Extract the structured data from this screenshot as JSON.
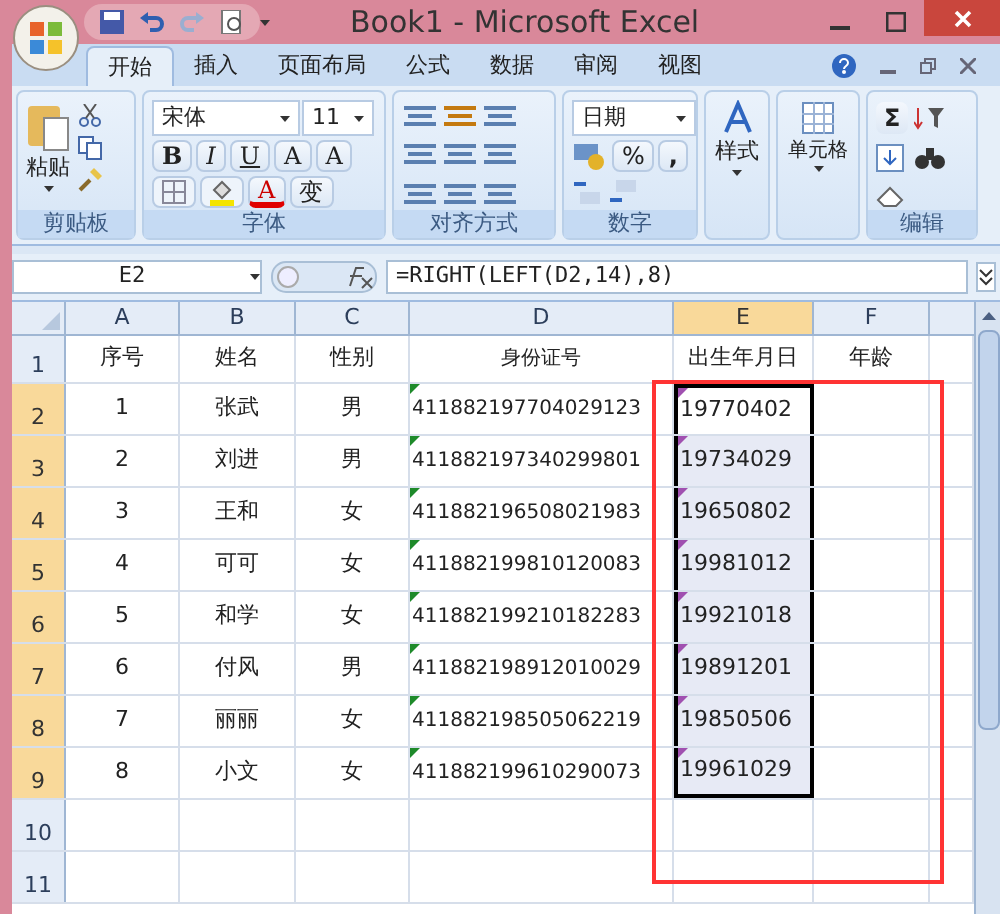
{
  "window": {
    "title": "Book1 - Microsoft Excel"
  },
  "tabs": [
    {
      "label": "开始",
      "selected": true
    },
    {
      "label": "插入",
      "selected": false
    },
    {
      "label": "页面布局",
      "selected": false
    },
    {
      "label": "公式",
      "selected": false
    },
    {
      "label": "数据",
      "selected": false
    },
    {
      "label": "审阅",
      "selected": false
    },
    {
      "label": "视图",
      "selected": false
    }
  ],
  "ribbon": {
    "paste": "粘贴",
    "font_name": "宋体",
    "font_size": "11",
    "bold": "B",
    "italic": "I",
    "underline": "U",
    "grow": "A",
    "shrink": "A",
    "font_color": "A",
    "phonetic": "变",
    "number_format": "日期",
    "percent": "%",
    "comma": ",",
    "styles": "样式",
    "cells": "单元格",
    "sum": "Σ",
    "groups": [
      {
        "label": "剪贴板"
      },
      {
        "label": "字体"
      },
      {
        "label": "对齐方式"
      },
      {
        "label": "数字"
      },
      {
        "label": "编辑"
      }
    ]
  },
  "formula_bar": {
    "name_box": "E2",
    "formula": "=RIGHT(LEFT(D2,14),8)"
  },
  "columns": [
    {
      "label": "A",
      "selected": false
    },
    {
      "label": "B",
      "selected": false
    },
    {
      "label": "C",
      "selected": false
    },
    {
      "label": "D",
      "selected": false
    },
    {
      "label": "E",
      "selected": true
    },
    {
      "label": "F",
      "selected": false
    }
  ],
  "rows": [
    {
      "header": "1",
      "selected": false,
      "marked": false,
      "cells": [
        "序号",
        "姓名",
        "性别",
        "身份证号",
        "出生年月日",
        "年龄"
      ]
    },
    {
      "header": "2",
      "selected": true,
      "marked": true,
      "cells": [
        "1",
        "张武",
        "男",
        "411882197704029123",
        "19770402"
      ]
    },
    {
      "header": "3",
      "selected": true,
      "marked": true,
      "cells": [
        "2",
        "刘进",
        "男",
        "411882197340299801",
        "19734029"
      ]
    },
    {
      "header": "4",
      "selected": true,
      "marked": true,
      "cells": [
        "3",
        "王和",
        "女",
        "411882196508021983",
        "19650802"
      ]
    },
    {
      "header": "5",
      "selected": true,
      "marked": true,
      "cells": [
        "4",
        "可可",
        "女",
        "411882199810120083",
        "19981012"
      ]
    },
    {
      "header": "6",
      "selected": true,
      "marked": true,
      "cells": [
        "5",
        "和学",
        "女",
        "411882199210182283",
        "19921018"
      ]
    },
    {
      "header": "7",
      "selected": true,
      "marked": true,
      "cells": [
        "6",
        "付风",
        "男",
        "411882198912010029",
        "19891201"
      ]
    },
    {
      "header": "8",
      "selected": true,
      "marked": true,
      "cells": [
        "7",
        "丽丽",
        "女",
        "411882198505062219",
        "19850506"
      ]
    },
    {
      "header": "9",
      "selected": true,
      "marked": true,
      "cells": [
        "8",
        "小文",
        "女",
        "411882199610290073",
        "19961029"
      ]
    },
    {
      "header": "10",
      "selected": false,
      "marked": false
    },
    {
      "header": "11",
      "selected": false,
      "marked": false
    }
  ],
  "annotation": {
    "color": "#ff3333"
  }
}
